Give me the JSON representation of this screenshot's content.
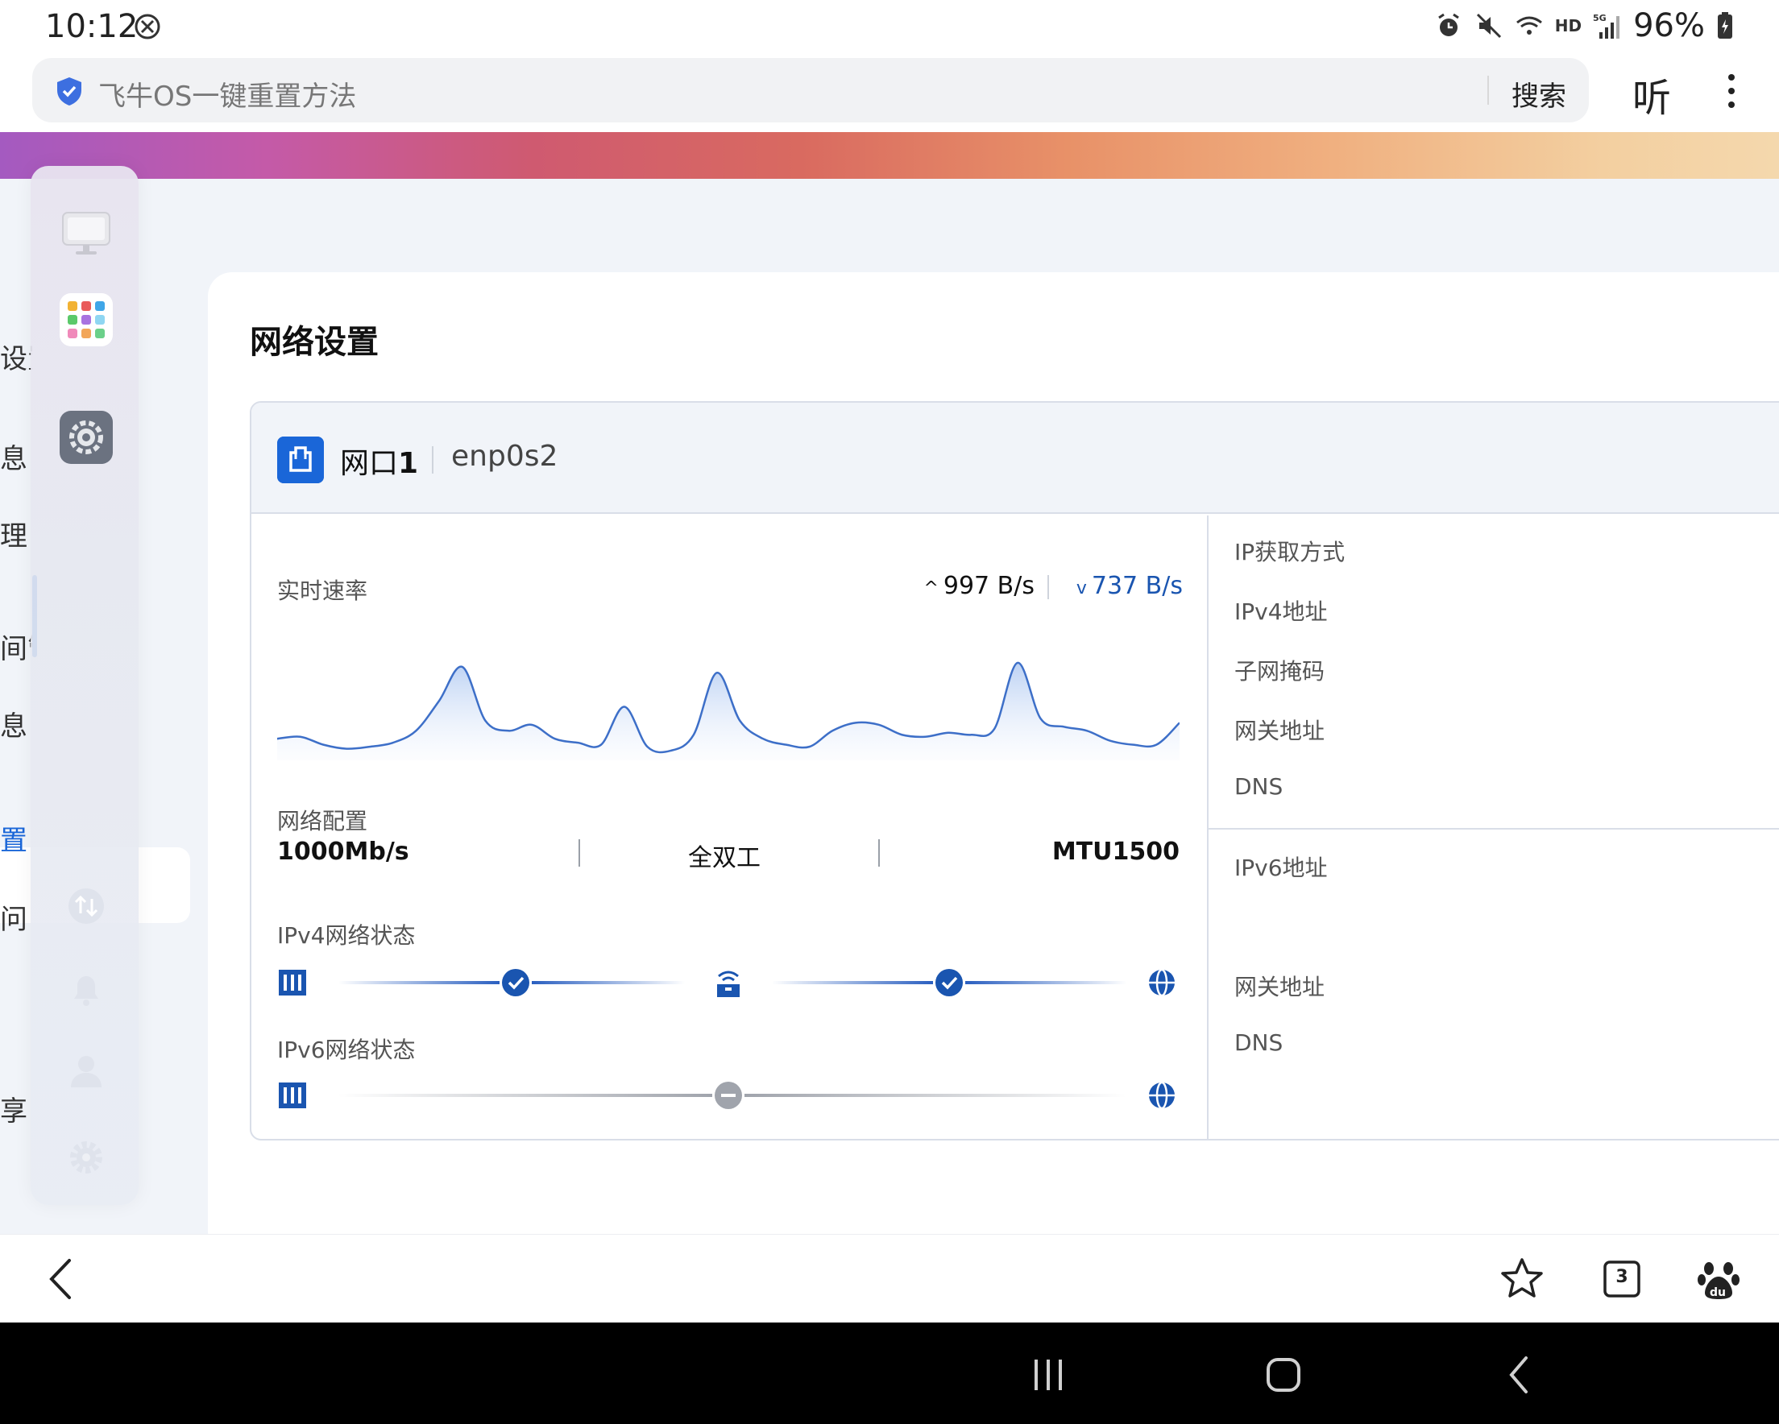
{
  "status_bar": {
    "time": "10:12",
    "battery": "96%",
    "network_badge": "HD",
    "icons": [
      "alarm-icon",
      "mute-icon",
      "wifi-icon",
      "signal-5g-icon",
      "battery-charging-icon"
    ]
  },
  "browser": {
    "search_query": "飞牛OS一键重置方法",
    "search_button": "搜索",
    "listen_button": "听",
    "tab_count": "3"
  },
  "sidebar_fragments": [
    {
      "text": "设置",
      "active": false
    },
    {
      "text": "息",
      "active": false
    },
    {
      "text": "理",
      "active": false
    },
    {
      "text": "间管",
      "active": false
    },
    {
      "text": "息",
      "active": false
    },
    {
      "text": "置",
      "active": true
    },
    {
      "text": "问",
      "active": false
    },
    {
      "text": "享",
      "active": false
    }
  ],
  "page": {
    "title": "网络设置"
  },
  "port": {
    "name_prefix": "网口",
    "name_number": "1",
    "interface": "enp0s2"
  },
  "realtime": {
    "label": "实时速率",
    "upload": "997 B/s",
    "download": "737 B/s"
  },
  "network_config": {
    "label": "网络配置",
    "speed": "1000Mb/s",
    "duplex": "全双工",
    "mtu": "MTU1500"
  },
  "ipv4_status": {
    "label": "IPv4网络状态",
    "link_nic_router": "ok",
    "link_router_internet": "ok"
  },
  "ipv6_status": {
    "label": "IPv6网络状态",
    "link": "disabled"
  },
  "right_info": {
    "ip_method": "IP获取方式",
    "ipv4_address": "IPv4地址",
    "subnet_mask": "子网掩码",
    "gateway": "网关地址",
    "dns": "DNS",
    "ipv6_address": "IPv6地址",
    "ipv6_gateway": "网关地址",
    "ipv6_dns": "DNS"
  },
  "chart_data": {
    "type": "area",
    "series": [
      {
        "values": [
          20,
          22,
          14,
          10,
          12,
          16,
          28,
          58,
          92,
          38,
          28,
          34,
          20,
          16,
          14,
          52,
          12,
          8,
          24,
          86,
          38,
          20,
          14,
          12,
          28,
          36,
          34,
          24,
          22,
          26,
          24,
          30,
          96,
          40,
          32,
          28,
          18,
          14,
          14,
          36
        ]
      }
    ],
    "title": "",
    "xlabel": "",
    "ylabel": ""
  },
  "colors": {
    "accent": "#1a66d8",
    "download_text": "#1a55b0",
    "card_bg": "#ffffff",
    "page_bg": "#f1f4f9"
  }
}
